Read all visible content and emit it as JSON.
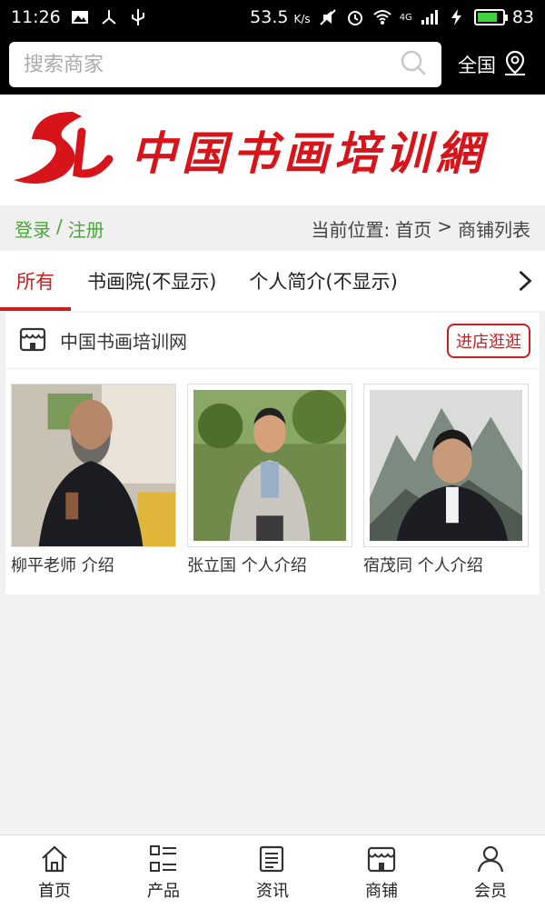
{
  "status_bar": {
    "time": "11:26",
    "speed": "53.5",
    "speed_unit": "K/s",
    "network": "4G",
    "battery": "83",
    "battery_level": 0.83
  },
  "search": {
    "placeholder": "搜索商家",
    "region_label": "全国"
  },
  "banner": {
    "logo_text": "SL",
    "title": "中国书画培训網"
  },
  "breadcrumb_row": {
    "login": "登录",
    "separator": "/",
    "register": "注册",
    "location_label": "当前位置:",
    "home": "首页",
    "arrow": ">",
    "current": "商铺列表"
  },
  "tabs": [
    {
      "label": "所有",
      "active": true
    },
    {
      "label": "书画院(不显示)",
      "active": false
    },
    {
      "label": "个人简介(不显示)",
      "active": false
    }
  ],
  "shop": {
    "name": "中国书画培训网",
    "enter_label": "进店逛逛",
    "items": [
      {
        "caption": "柳平老师 介绍"
      },
      {
        "caption": "张立国 个人介绍"
      },
      {
        "caption": "宿茂同 个人介绍"
      }
    ]
  },
  "bottom_nav": [
    {
      "label": "首页",
      "icon": "home-icon"
    },
    {
      "label": "产品",
      "icon": "list-icon"
    },
    {
      "label": "资讯",
      "icon": "news-icon"
    },
    {
      "label": "商铺",
      "icon": "store-icon"
    },
    {
      "label": "会员",
      "icon": "user-icon"
    }
  ],
  "colors": {
    "accent_red": "#c51f1f",
    "brand_red": "#d7141a",
    "login_green": "#4aa53a"
  }
}
